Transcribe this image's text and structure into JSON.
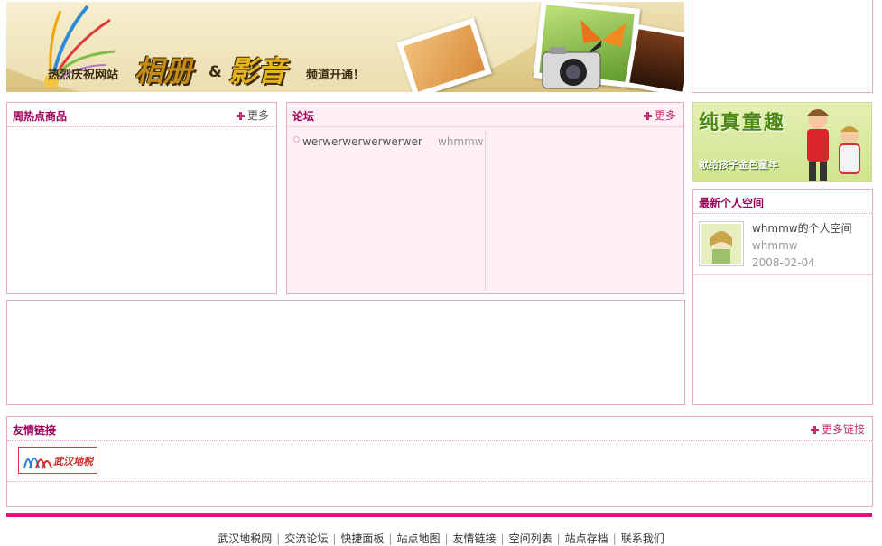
{
  "banner": {
    "text_left": "热烈庆祝网站",
    "big_word_1": "相册",
    "amp": "&",
    "big_word_2": "影音",
    "text_right": "频道开通！"
  },
  "hot_goods": {
    "title": "周热点商品",
    "more": "更多"
  },
  "forum": {
    "title": "论坛",
    "more": "更多",
    "posts": [
      {
        "title": "werwerwerwerwerwer",
        "author": "whmmw"
      }
    ]
  },
  "kids_ad": {
    "headline": "纯真童趣",
    "caption": "献给孩子金色童年"
  },
  "latest_spaces": {
    "title": "最新个人空间",
    "items": [
      {
        "name": "whmmw的个人空间",
        "user": "whmmw",
        "date": "2008-02-04"
      }
    ]
  },
  "friend_links": {
    "title": "友情链接",
    "more": "更多链接",
    "logo_text": "武汉地税"
  },
  "footer": {
    "links": [
      "武汉地税网",
      "交流论坛",
      "快捷面板",
      "站点地图",
      "友情链接",
      "空间列表",
      "站点存档",
      "联系我们"
    ]
  },
  "colors": {
    "accent": "#e0127d",
    "title": "#a0005a",
    "border": "#e7a9c4"
  }
}
